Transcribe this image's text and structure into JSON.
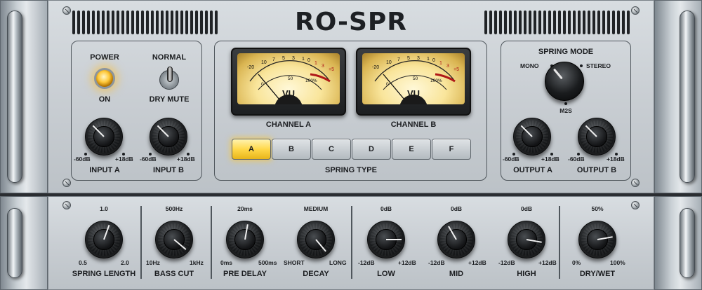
{
  "title": "RO-SPR",
  "colors": {
    "lamp": "#ffc93a",
    "active_button": "#ffd84a",
    "panel": "#c9ced3",
    "knob": "#1a1c1e"
  },
  "top": {
    "power": {
      "label": "POWER",
      "state_label": "ON",
      "on": true
    },
    "dry_mute": {
      "label": "NORMAL",
      "state_label": "DRY MUTE",
      "muted": false
    },
    "input_a": {
      "label": "INPUT A",
      "min": "-60dB",
      "max": "+18dB"
    },
    "input_b": {
      "label": "INPUT B",
      "min": "-60dB",
      "max": "+18dB"
    },
    "meters": [
      {
        "label": "CHANNEL A",
        "vu": "VU",
        "scale_top": [
          "-20",
          "10",
          "7",
          "5",
          "3",
          "1",
          "0",
          "1",
          "3",
          "+5"
        ],
        "scale_bottom": [
          "0",
          "50",
          "100%"
        ]
      },
      {
        "label": "CHANNEL B",
        "vu": "VU",
        "scale_top": [
          "-20",
          "10",
          "7",
          "5",
          "3",
          "1",
          "0",
          "1",
          "3",
          "+5"
        ],
        "scale_bottom": [
          "0",
          "50",
          "100%"
        ]
      }
    ],
    "spring_type": {
      "label": "SPRING TYPE",
      "options": [
        "A",
        "B",
        "C",
        "D",
        "E",
        "F"
      ],
      "selected": "A"
    },
    "spring_mode": {
      "label": "SPRING MODE",
      "options": [
        "MONO",
        "STEREO",
        "M2S"
      ],
      "selected": "MONO"
    },
    "output_a": {
      "label": "OUTPUT A",
      "min": "-60dB",
      "max": "+18dB"
    },
    "output_b": {
      "label": "OUTPUT B",
      "min": "-60dB",
      "max": "+18dB"
    }
  },
  "bottom": {
    "knobs": [
      {
        "label": "SPRING LENGTH",
        "top": "1.0",
        "min": "0.5",
        "max": "2.0"
      },
      {
        "label": "BASS CUT",
        "top": "500Hz",
        "min": "10Hz",
        "max": "1kHz"
      },
      {
        "label": "PRE DELAY",
        "top": "20ms",
        "min": "0ms",
        "max": "500ms"
      },
      {
        "label": "DECAY",
        "top": "MEDIUM",
        "min": "SHORT",
        "max": "LONG"
      },
      {
        "label": "LOW",
        "top": "0dB",
        "min": "-12dB",
        "max": "+12dB"
      },
      {
        "label": "MID",
        "top": "0dB",
        "min": "-12dB",
        "max": "+12dB"
      },
      {
        "label": "HIGH",
        "top": "0dB",
        "min": "-12dB",
        "max": "+12dB"
      },
      {
        "label": "DRY/WET",
        "top": "50%",
        "min": "0%",
        "max": "100%"
      }
    ]
  }
}
